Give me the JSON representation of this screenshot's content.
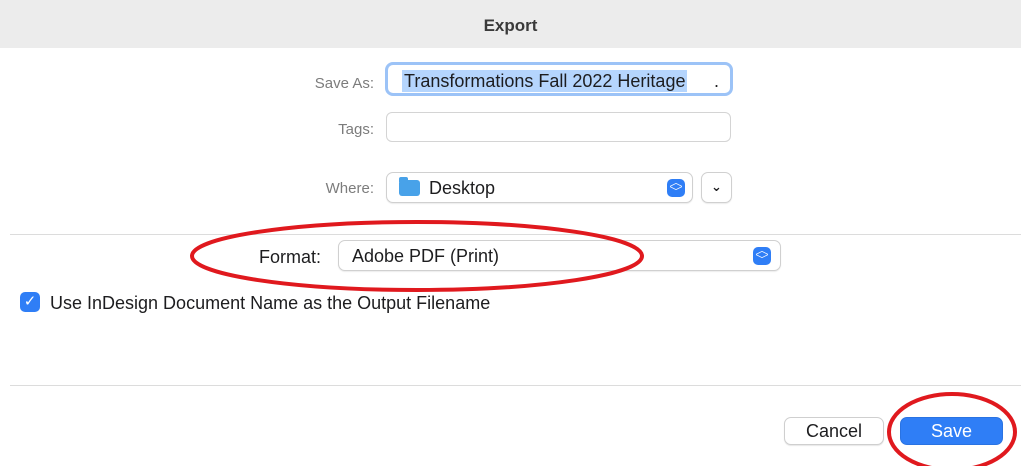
{
  "dialog": {
    "title": "Export"
  },
  "save_as": {
    "label": "Save As:",
    "value": "Transformations Fall 2022 Heritage",
    "suffix": "."
  },
  "tags": {
    "label": "Tags:",
    "value": ""
  },
  "where": {
    "label": "Where:",
    "value": "Desktop",
    "icon": "folder-icon"
  },
  "format": {
    "label": "Format:",
    "value": "Adobe PDF (Print)"
  },
  "option": {
    "checked": true,
    "label": "Use InDesign Document Name as the Output Filename"
  },
  "buttons": {
    "cancel": "Cancel",
    "save": "Save"
  },
  "colors": {
    "accent": "#2f7ef6",
    "annotation": "#e0191e",
    "selection": "#b5d5fd"
  }
}
